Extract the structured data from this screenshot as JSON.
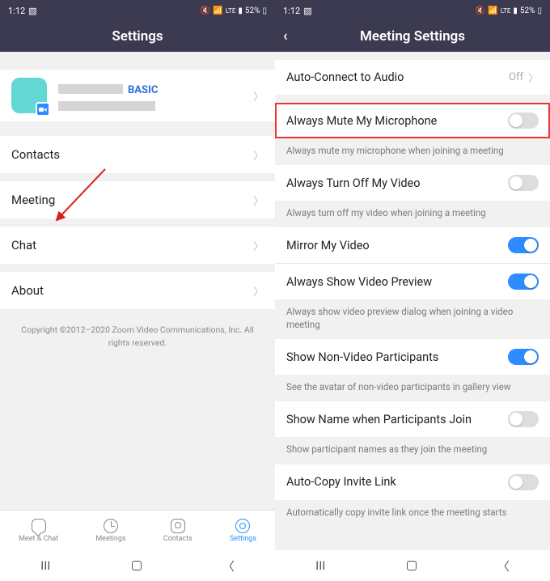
{
  "status": {
    "time": "1:12",
    "battery": "52%"
  },
  "left": {
    "title": "Settings",
    "badge": "BASIC",
    "items": [
      "Contacts",
      "Meeting",
      "Chat",
      "About"
    ],
    "copyright": "Copyright ©2012–2020 Zoom Video Communications, Inc. All rights reserved.",
    "tabs": [
      "Meet & Chat",
      "Meetings",
      "Contacts",
      "Settings"
    ]
  },
  "right": {
    "title": "Meeting Settings",
    "rows": [
      {
        "label": "Auto-Connect to Audio",
        "value": "Off",
        "type": "link"
      },
      {
        "label": "Always Mute My Microphone",
        "type": "toggle",
        "on": false,
        "desc": "Always mute my microphone when joining a meeting",
        "highlight": true
      },
      {
        "label": "Always Turn Off My Video",
        "type": "toggle",
        "on": false,
        "desc": "Always turn off my video when joining a meeting"
      },
      {
        "label": "Mirror My Video",
        "type": "toggle",
        "on": true
      },
      {
        "label": "Always Show Video Preview",
        "type": "toggle",
        "on": true,
        "desc": "Always show video preview dialog when joining a video meeting"
      },
      {
        "label": "Show Non-Video Participants",
        "type": "toggle",
        "on": true,
        "desc": "See the avatar of non-video participants in gallery view"
      },
      {
        "label": "Show Name when Participants Join",
        "type": "toggle",
        "on": false,
        "desc": "Show participant names as they join the meeting"
      },
      {
        "label": "Auto-Copy Invite Link",
        "type": "toggle",
        "on": false,
        "desc": "Automatically copy invite link once the meeting starts"
      }
    ]
  }
}
